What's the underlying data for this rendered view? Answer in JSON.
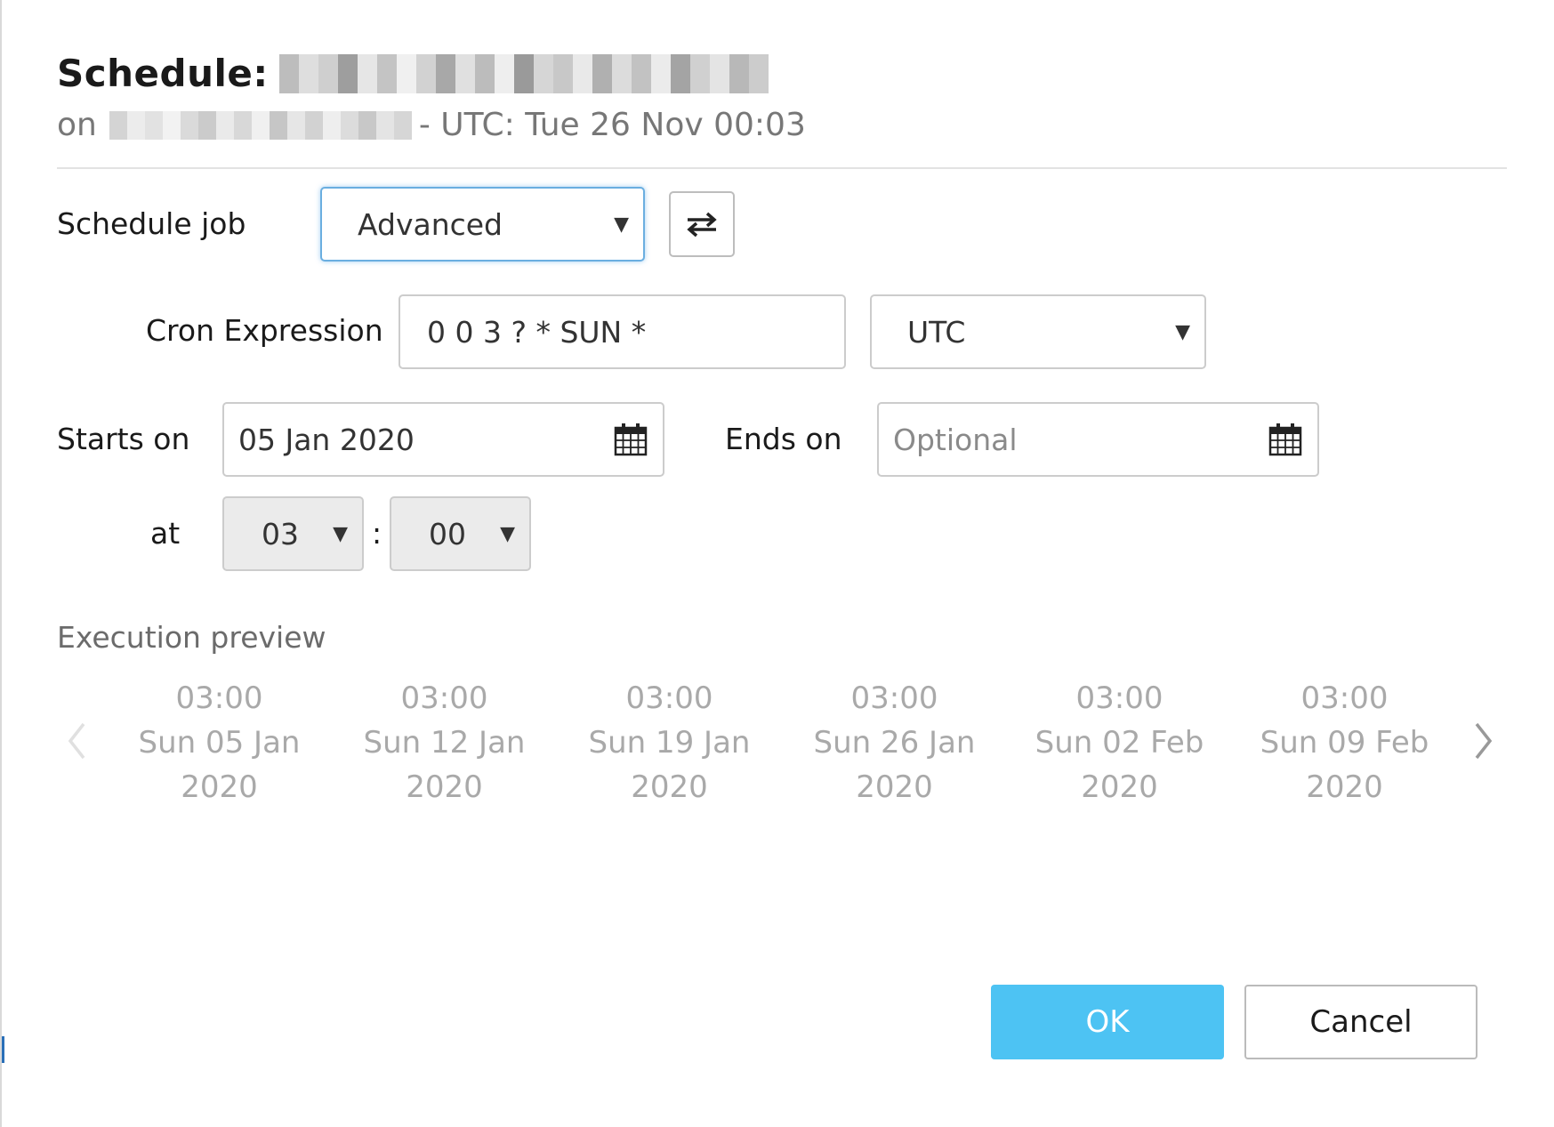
{
  "header": {
    "title_prefix": "Schedule:",
    "subtitle_prefix": "on",
    "subtitle_suffix": "- UTC: Tue 26 Nov 00:03"
  },
  "schedule_job": {
    "label": "Schedule job",
    "value": "Advanced",
    "toggle_icon": "swap-arrows-icon"
  },
  "cron": {
    "label": "Cron Expression",
    "value": "0 0 3 ? * SUN *",
    "timezone": "UTC"
  },
  "starts_on": {
    "label": "Starts on",
    "value": "05 Jan 2020"
  },
  "ends_on": {
    "label": "Ends on",
    "placeholder": "Optional"
  },
  "time": {
    "label": "at",
    "hour": "03",
    "separator": ":",
    "minute": "00"
  },
  "preview": {
    "title": "Execution preview",
    "items": [
      {
        "time": "03:00",
        "date": "Sun 05 Jan",
        "year": "2020"
      },
      {
        "time": "03:00",
        "date": "Sun 12 Jan",
        "year": "2020"
      },
      {
        "time": "03:00",
        "date": "Sun 19 Jan",
        "year": "2020"
      },
      {
        "time": "03:00",
        "date": "Sun 26 Jan",
        "year": "2020"
      },
      {
        "time": "03:00",
        "date": "Sun 02 Feb",
        "year": "2020"
      },
      {
        "time": "03:00",
        "date": "Sun 09 Feb",
        "year": "2020"
      }
    ]
  },
  "buttons": {
    "ok": "OK",
    "cancel": "Cancel"
  },
  "colors": {
    "ok_button": "#4dc3f3",
    "focus_border": "#6aaee0",
    "disabled_select": "#ebebeb"
  }
}
